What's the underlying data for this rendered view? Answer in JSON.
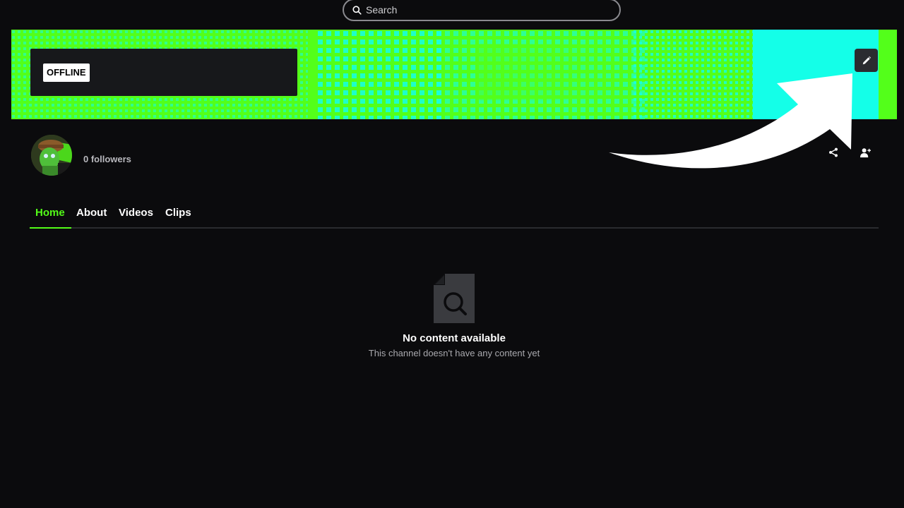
{
  "search": {
    "placeholder": "Search"
  },
  "banner": {
    "status_badge": "OFFLINE",
    "colors": {
      "green": "#53ff1a",
      "cyan": "#14ffe8"
    }
  },
  "channel": {
    "followers_text": "0 followers"
  },
  "tabs": [
    {
      "label": "Home",
      "active": true
    },
    {
      "label": "About",
      "active": false
    },
    {
      "label": "Videos",
      "active": false
    },
    {
      "label": "Clips",
      "active": false
    }
  ],
  "empty_state": {
    "title": "No content available",
    "subtitle": "This channel doesn't have any content yet"
  },
  "icons": {
    "search": "search-icon",
    "edit": "pencil-icon",
    "share": "share-icon",
    "follow": "person-add-icon",
    "empty": "document-search-icon",
    "annotation": "arrow-annotation"
  },
  "colors": {
    "accent": "#53fc18",
    "background": "#0b0b0d",
    "muted_text": "#a9a9ae"
  }
}
